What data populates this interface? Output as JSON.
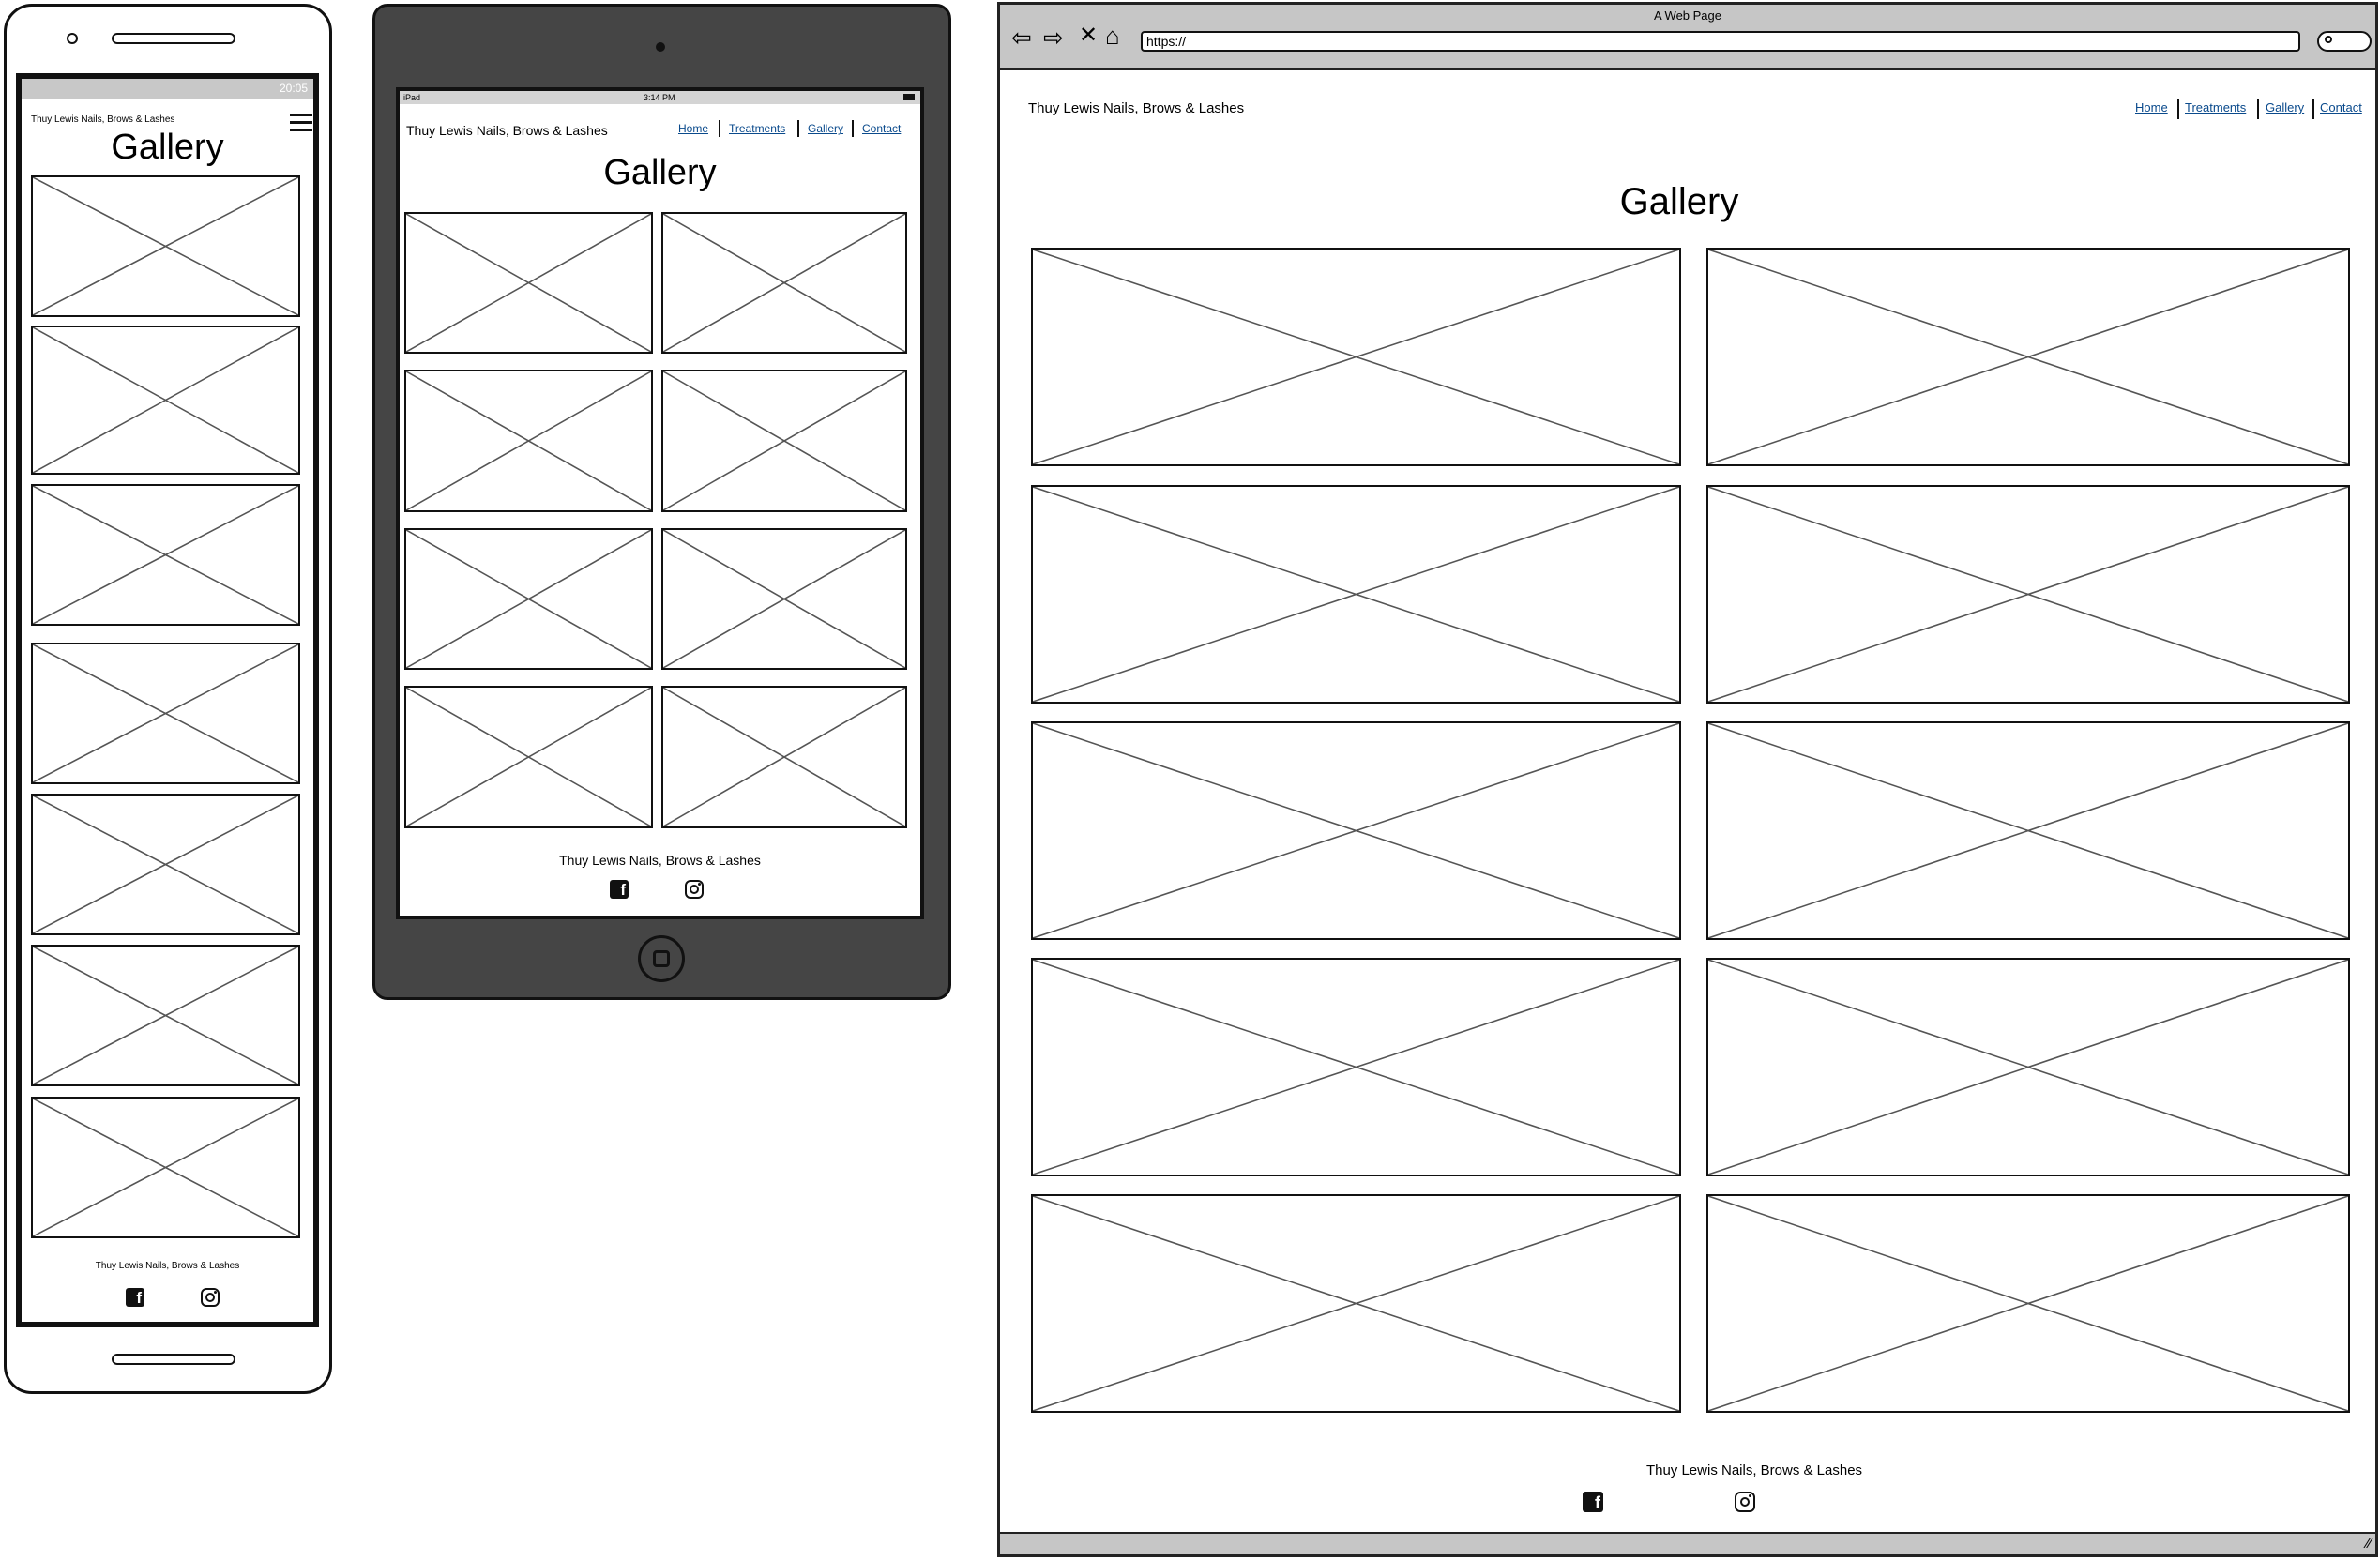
{
  "brand": "Thuy Lewis Nails, Brows & Lashes",
  "page_title": "Gallery",
  "footer_brand": "Thuy Lewis Nails, Brows & Lashes",
  "nav": {
    "home": "Home",
    "treatments": "Treatments",
    "gallery": "Gallery",
    "contact": "Contact"
  },
  "phone": {
    "status_time": "20:05"
  },
  "tablet": {
    "status_device": "iPad",
    "status_time": "3:14 PM"
  },
  "browser": {
    "window_title": "A Web Page",
    "url": "https://"
  },
  "icons": {
    "phone_menu": "hamburger-icon",
    "facebook": "facebook-icon",
    "instagram": "instagram-icon",
    "back": "back-arrow-icon",
    "forward": "forward-arrow-icon",
    "stop": "close-icon",
    "home": "home-icon",
    "search": "search-icon",
    "resize": "resize-grip-icon"
  },
  "colors": {
    "link": "#0a4a8c",
    "device_frame": "#454545",
    "chrome": "#c6c6c6",
    "placeholder_line": "#555555"
  }
}
